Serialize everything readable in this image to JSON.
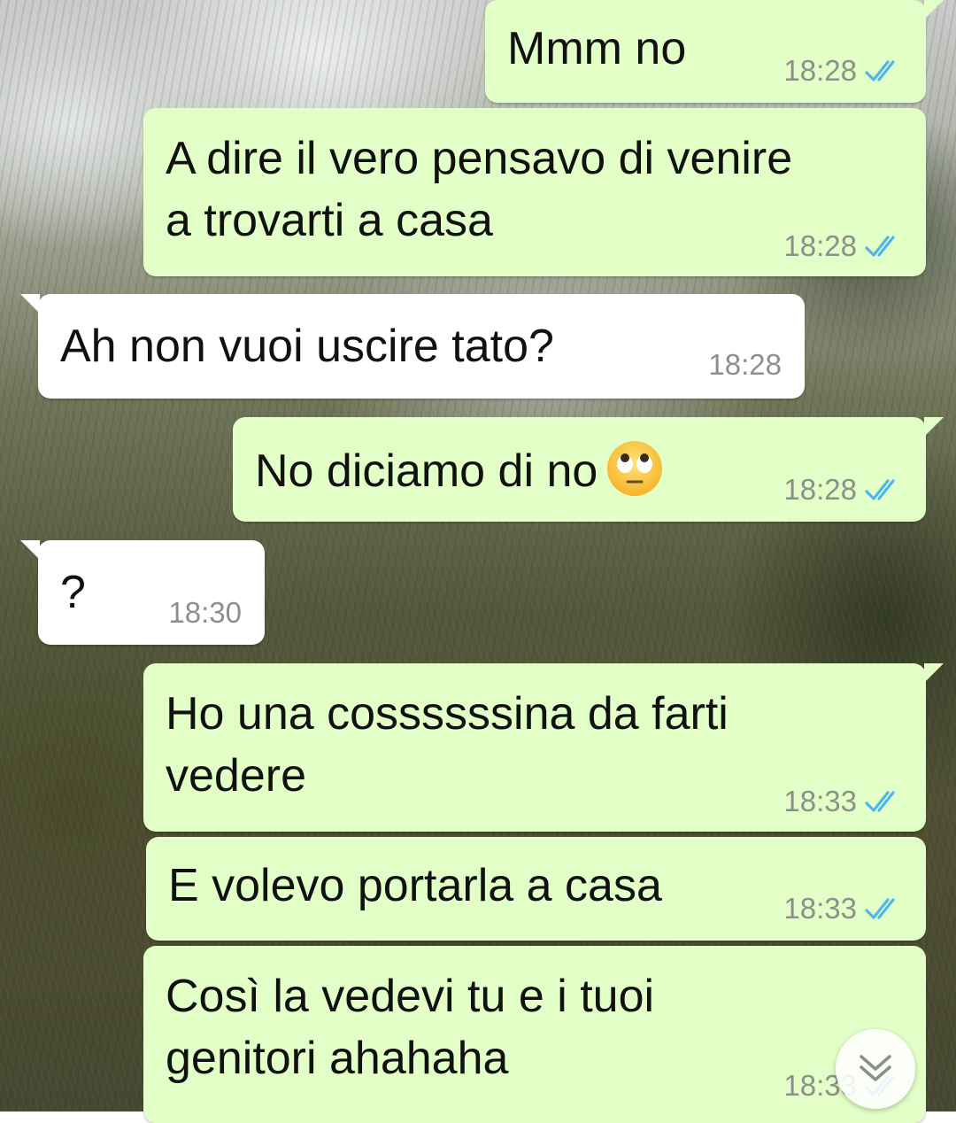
{
  "messages": [
    {
      "id": "m1",
      "direction": "outgoing",
      "text": "Mmm no",
      "time": "18:28",
      "status": "read"
    },
    {
      "id": "m2",
      "direction": "outgoing",
      "text": "A dire il vero pensavo di venire\na trovarti a casa",
      "time": "18:28",
      "status": "read"
    },
    {
      "id": "m3",
      "direction": "incoming",
      "text": "Ah non vuoi uscire tato?",
      "time": "18:28"
    },
    {
      "id": "m4",
      "direction": "outgoing",
      "text": "No diciamo di no",
      "emoji": "face-with-rolling-eyes",
      "time": "18:28",
      "status": "read"
    },
    {
      "id": "m5",
      "direction": "incoming",
      "text": "?",
      "time": "18:30"
    },
    {
      "id": "m6",
      "direction": "outgoing",
      "text": "Ho una cossssssina da farti\nvedere",
      "time": "18:33",
      "status": "read"
    },
    {
      "id": "m7",
      "direction": "outgoing",
      "text": "E volevo portarla a casa",
      "time": "18:33",
      "status": "read"
    },
    {
      "id": "m8",
      "direction": "outgoing",
      "text": "Così la vedevi tu e i tuoi\ngenitori ahahaha",
      "time": "18:33",
      "status": "read"
    }
  ],
  "icons": {
    "read_ticks": "double-check-icon",
    "scroll_down": "double-chevron-down-icon"
  },
  "colors": {
    "outgoing_bubble": "#e2ffc7",
    "incoming_bubble": "#ffffff",
    "read_tick": "#4fb6ec",
    "timestamp": "#8c8f8a"
  }
}
